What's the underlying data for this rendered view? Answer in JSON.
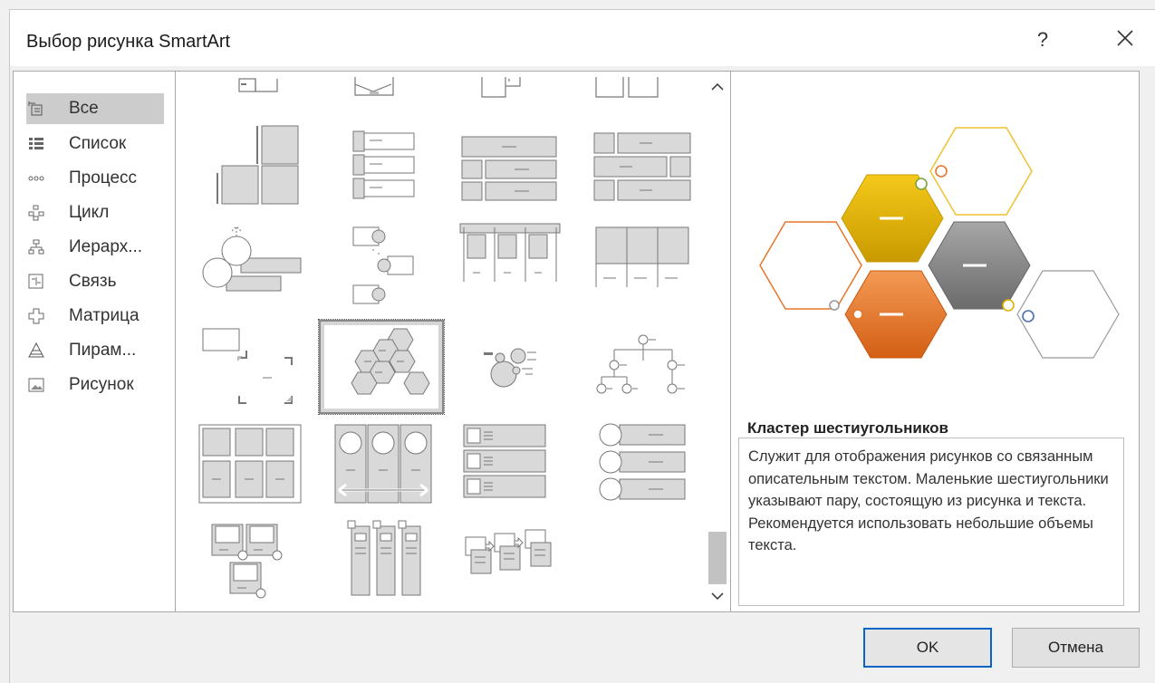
{
  "window": {
    "title": "Выбор рисунка SmartArt",
    "help_label": "?"
  },
  "categories": [
    {
      "label": "Все",
      "icon": "all-icon",
      "selected": true
    },
    {
      "label": "Список",
      "icon": "list-icon"
    },
    {
      "label": "Процесс",
      "icon": "process-icon"
    },
    {
      "label": "Цикл",
      "icon": "cycle-icon"
    },
    {
      "label": "Иерарх...",
      "icon": "hierarchy-icon"
    },
    {
      "label": "Связь",
      "icon": "relationship-icon"
    },
    {
      "label": "Матрица",
      "icon": "matrix-icon"
    },
    {
      "label": "Пирам...",
      "icon": "pyramid-icon"
    },
    {
      "label": "Рисунок",
      "icon": "picture-icon"
    }
  ],
  "preview": {
    "title": "Кластер шестиугольников",
    "description": "Служит для отображения рисунков со связанным описательным текстом. Маленькие шестиугольники указывают пару, состоящую из рисунка и текста. Рекомендуется использовать небольшие объемы текста.",
    "colors": {
      "gold": "#e6b800",
      "gray": "#7f7f7f",
      "orange": "#e8752a",
      "blue": "#4a6fb0"
    }
  },
  "buttons": {
    "ok": "OK",
    "cancel": "Отмена"
  },
  "gallery": {
    "selected_layout": "hexagon-cluster"
  }
}
